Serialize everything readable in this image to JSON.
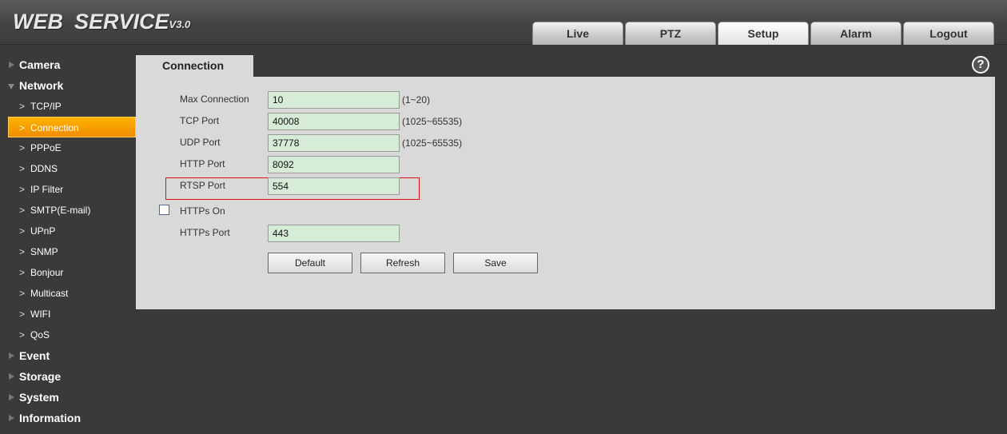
{
  "header": {
    "logo_main1": "WEB",
    "logo_main2": "SERVICE",
    "logo_version": "V3.0",
    "tabs": [
      {
        "label": "Live"
      },
      {
        "label": "PTZ"
      },
      {
        "label": "Setup",
        "active": true
      },
      {
        "label": "Alarm"
      },
      {
        "label": "Logout"
      }
    ]
  },
  "sidebar": {
    "camera": "Camera",
    "network": "Network",
    "network_items": [
      "TCP/IP",
      "Connection",
      "PPPoE",
      "DDNS",
      "IP Filter",
      "SMTP(E-mail)",
      "UPnP",
      "SNMP",
      "Bonjour",
      "Multicast",
      "WIFI",
      "QoS"
    ],
    "active_item": "Connection",
    "event": "Event",
    "storage": "Storage",
    "system": "System",
    "information": "Information"
  },
  "content": {
    "tab_label": "Connection",
    "help_icon": "?",
    "fields": {
      "max_connection": {
        "label": "Max Connection",
        "value": "10",
        "hint": "(1~20)"
      },
      "tcp_port": {
        "label": "TCP Port",
        "value": "40008",
        "hint": "(1025~65535)"
      },
      "udp_port": {
        "label": "UDP Port",
        "value": "37778",
        "hint": "(1025~65535)"
      },
      "http_port": {
        "label": "HTTP Port",
        "value": "8092"
      },
      "rtsp_port": {
        "label": "RTSP Port",
        "value": "554"
      },
      "https_on": {
        "label": "HTTPs On",
        "checked": false
      },
      "https_port": {
        "label": "HTTPs Port",
        "value": "443"
      }
    },
    "buttons": {
      "default": "Default",
      "refresh": "Refresh",
      "save": "Save"
    }
  },
  "colors": {
    "active_orange": "#f5a000",
    "input_green": "#d6ecd6",
    "highlight_red": "#dd1111"
  }
}
